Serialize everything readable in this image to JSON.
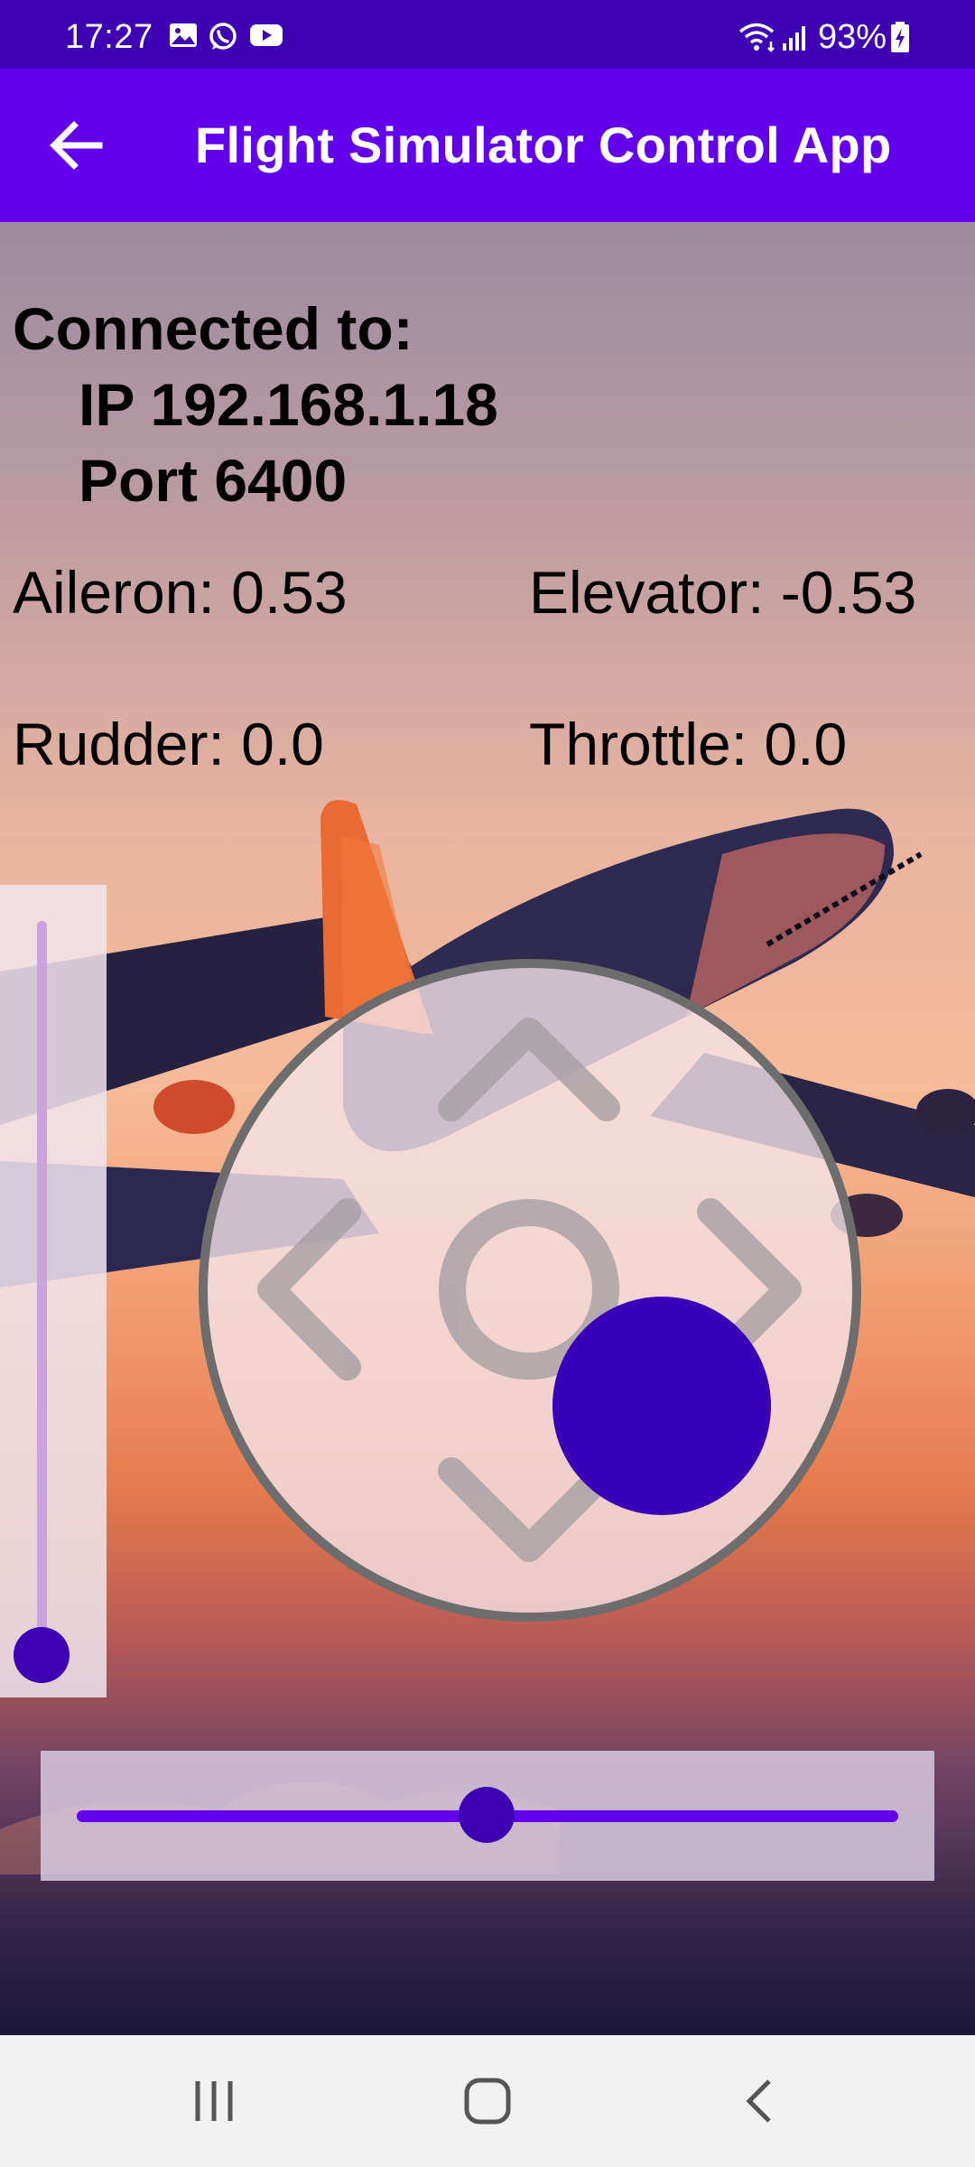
{
  "status_bar": {
    "time": "17:27",
    "notification_icons": [
      "gallery-icon",
      "whatsapp-icon",
      "youtube-icon"
    ],
    "signal_icons": [
      "wifi-icon",
      "cell-signal-icon"
    ],
    "battery_percent": "93%",
    "battery_charging": true
  },
  "app_bar": {
    "title": "Flight Simulator Control App",
    "back_icon": "arrow-back-icon"
  },
  "connection": {
    "heading": "Connected to:",
    "ip": "IP 192.168.1.18",
    "port": "Port 6400"
  },
  "controls": {
    "aileron": "Aileron: 0.53",
    "elevator": "Elevator: -0.53",
    "rudder": "Rudder: 0.0",
    "throttle": "Throttle: 0.0"
  },
  "sliders": {
    "throttle_fraction": 0.0,
    "rudder_fraction": 0.5
  },
  "joystick": {
    "aileron_value": 0.53,
    "elevator_value": -0.53
  },
  "colors": {
    "status_bar": "#3d00b3",
    "app_bar": "#6200ee",
    "accent": "#3a00b7"
  },
  "nav_bar": {
    "icons": [
      "recent-apps-icon",
      "home-icon",
      "back-nav-icon"
    ]
  }
}
